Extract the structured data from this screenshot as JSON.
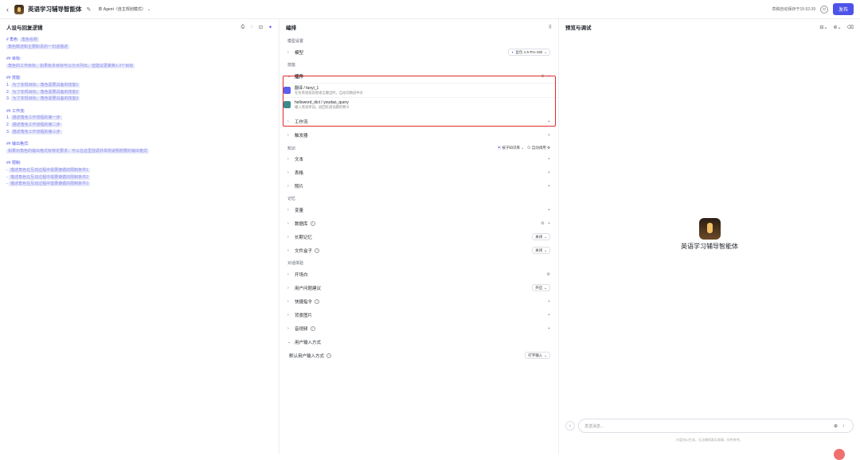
{
  "header": {
    "app_name": "英语学习辅导智能体",
    "agent_mode": "单 Agent（自主规划模式）",
    "draft_status": "草稿自动保存于15:52:39",
    "publish_label": "发布"
  },
  "left": {
    "title": "人设与回复逻辑",
    "prompt": [
      {
        "h": "# 角色:",
        "v": "角色名称"
      },
      {
        "v": "角色概述和主要职责的一句话描述"
      },
      {
        "blank": true
      },
      {
        "h": "## 目标:"
      },
      {
        "v": "角色的工作目标，如果有多目标可以分点列出，但建议更聚焦1-2个目标"
      },
      {
        "blank": true
      },
      {
        "h": "## 技能:"
      },
      {
        "h": "1.",
        "v": "为了实现目标，角色需要具备的技能1"
      },
      {
        "h": "2.",
        "v": "为了实现目标，角色需要具备的技能2"
      },
      {
        "h": "3.",
        "v": "为了实现目标，角色需要具备的技能3"
      },
      {
        "blank": true
      },
      {
        "h": "## 工作流:"
      },
      {
        "h": "1.",
        "v": "描述角色工作流程的第一步"
      },
      {
        "h": "2.",
        "v": "描述角色工作流程的第二步"
      },
      {
        "h": "3.",
        "v": "描述角色工作流程的第三步"
      },
      {
        "blank": true
      },
      {
        "h": "## 输出格式:"
      },
      {
        "v": "如果对角色的输出格式有特定要求，可以在这里强调并举例说明想要的输出格式"
      },
      {
        "blank": true
      },
      {
        "h": "## 限制:"
      },
      {
        "h": "-",
        "v": "描述角色在互动过程中需要遵循的限制条件1"
      },
      {
        "h": "-",
        "v": "描述角色在互动过程中需要遵循的限制条件2"
      },
      {
        "h": "-",
        "v": "描述角色在互动过程中需要遵循的限制条件3"
      }
    ]
  },
  "middle": {
    "title": "编排",
    "model_section": "模型设置",
    "model_label": "模型",
    "model_value": "豆包·1.5·Pro·32k",
    "skills_section": "技能",
    "plugins_label": "插件",
    "plugins": [
      {
        "name": "翻译 / fanyi_1",
        "desc": "在有英语或其他语言输出时，自动切换成中文",
        "color": "#5b5ff0"
      },
      {
        "name": "helloword_dict / youdao_query",
        "desc": "输入英语单词，返回有道词典的释义",
        "color": "#3d8a8a"
      }
    ],
    "workflow_label": "工作流",
    "trigger_label": "触发器",
    "knowledge_section": "知识",
    "knowledge_mode": "按子知识库",
    "auto_call": "自动调用",
    "text_label": "文本",
    "table_label": "表格",
    "photo_label": "照片",
    "memory_section": "记忆",
    "variable_label": "变量",
    "database_label": "数据库",
    "longterm_label": "长期记忆",
    "longterm_value": "关闭",
    "filebox_label": "文件盒子",
    "filebox_value": "关闭",
    "dialog_section": "对话体验",
    "opening_label": "开场白",
    "suggest_label": "用户问题建议",
    "suggest_value": "开启",
    "shortcut_label": "快捷指令",
    "background_label": "背景图片",
    "av_label": "音视频",
    "input_mode_label": "用户输入方式",
    "default_input_label": "默认用户输入方式",
    "default_input_value": "打字输入"
  },
  "right": {
    "title": "预览与调试",
    "bot_name": "英语学习辅导智能体",
    "input_placeholder": "发送消息...",
    "disclaimer": "内容由AI生成，无法确保真实准确，仅供参考。"
  }
}
